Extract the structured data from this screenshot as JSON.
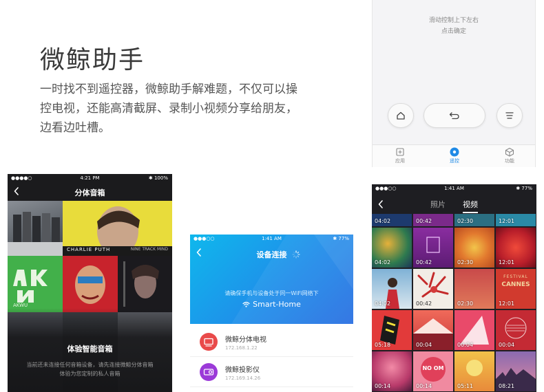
{
  "hero": {
    "title": "微鲸助手",
    "desc_line1": "一时找不到遥控器，微鲸助手解难题，不仅可以操",
    "desc_line2": "控电视，还能高清截屏、录制小视频分享给朋友，",
    "desc_line3": "边看边吐槽。"
  },
  "remote": {
    "hint_line1": "滑动控制上下左右",
    "hint_line2": "点击确定",
    "buttons": [
      "home-icon",
      "back-icon",
      "menu-icon"
    ],
    "tabs": [
      {
        "label": "应用",
        "icon": "apps-icon"
      },
      {
        "label": "遥控",
        "icon": "remote-icon",
        "active": true
      },
      {
        "label": "功能",
        "icon": "cube-icon"
      }
    ],
    "accent": "#1f8ae6"
  },
  "speaker_phone": {
    "carrier": "●●●●○ ",
    "time": "4:21 PM",
    "battery": "✱ 100%",
    "title": "分体音箱",
    "tile_text": {
      "charlie": "CHARLIE PUTH",
      "charlie_right": "NINE TRACK MIND",
      "akwu": "AKWU"
    },
    "heading": "体验智能音箱",
    "sub_line1": "当前还未连接任何音箱设备，请先连接微鲸分体音箱",
    "sub_line2": "体验为您定制的私人音箱"
  },
  "connect_phone": {
    "carrier": "●●●○○",
    "time": "1:41 AM",
    "battery": "✱ 77%",
    "title": "设备连接",
    "hint": "请确保手机与设备处于同一WiFi网络下",
    "wifi_name": "Smart-Home",
    "devices": [
      {
        "name": "微鲸分体电视",
        "ip": "172.168.1.22",
        "color": "#e94a4a",
        "icon": "tv-icon"
      },
      {
        "name": "微鲸投影仪",
        "ip": "172.169.14.26",
        "color": "#9b3ad8",
        "icon": "projector-icon"
      }
    ]
  },
  "gallery_phone": {
    "carrier": "●●●○○",
    "time": "1:41 AM",
    "battery": "✱ 77%",
    "tab_photos": "照片",
    "tab_videos": "视频",
    "tile_text": {
      "festival": "FESTIVAL",
      "cannes": "CANNES",
      "noom": "NO OM"
    },
    "durations": [
      [
        "04:02",
        "00:42",
        "02:30",
        "12:01"
      ],
      [
        "04:02",
        "00:42",
        "02:30",
        "12:01"
      ],
      [
        "04:02",
        "00:42",
        "02:30",
        "12:01"
      ],
      [
        "05:18",
        "00:04",
        "00:04",
        "00:04"
      ],
      [
        "00:14",
        "00:14",
        "05:11",
        "08:21"
      ]
    ]
  }
}
